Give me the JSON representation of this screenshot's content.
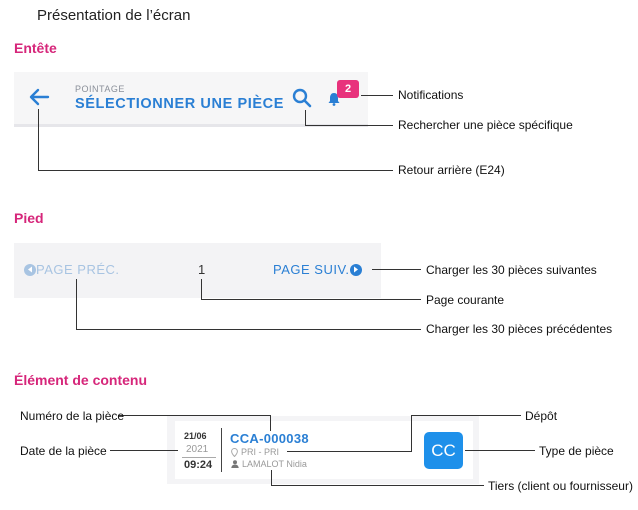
{
  "page_title": "Présentation de l’écran",
  "sections": {
    "header": "Entête",
    "footer": "Pied",
    "content": "Élément de contenu"
  },
  "header_mock": {
    "subtitle": "POINTAGE",
    "title": "SÉLECTIONNER UNE PIÈCE",
    "notification_count": "2",
    "icons": [
      "arrow-left-icon",
      "search-icon",
      "bell-icon"
    ],
    "accent_color": "#2a7fd4",
    "badge_color": "#e8327c"
  },
  "header_annotations": {
    "notifications": "Notifications",
    "search": "Rechercher une pièce spécifique",
    "back": "Retour arrière (E24)"
  },
  "footer_mock": {
    "prev_label": "PAGE PRÉC.",
    "page_number": "1",
    "next_label": "PAGE SUIV."
  },
  "footer_annotations": {
    "next": "Charger les 30 pièces suivantes",
    "current": "Page courante",
    "prev": "Charger les 30 pièces précédentes"
  },
  "item_mock": {
    "date_daymonth": "21/06",
    "date_year": "2021",
    "time": "09:24",
    "piece_number": "CCA-000038",
    "depot": "PRI - PRI",
    "tiers": "LAMALOT Nidia",
    "type_code": "CC",
    "type_color": "#1e90ea"
  },
  "item_annotations": {
    "piece_number": "Numéro de la pièce",
    "date": "Date de la pièce",
    "depot": "Dépôt",
    "type": "Type de pièce",
    "tiers": "Tiers (client ou fournisseur)"
  }
}
